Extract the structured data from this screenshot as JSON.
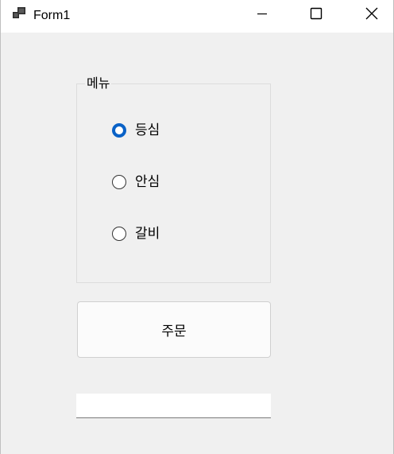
{
  "window": {
    "title": "Form1",
    "controls": {
      "minimize": "minimize",
      "maximize": "maximize",
      "close": "close"
    }
  },
  "menu_group": {
    "label": "메뉴",
    "options": [
      {
        "label": "등심",
        "checked": true
      },
      {
        "label": "안심",
        "checked": false
      },
      {
        "label": "갈비",
        "checked": false
      }
    ]
  },
  "order_button": {
    "label": "주문"
  },
  "result_textbox": {
    "value": ""
  },
  "colors": {
    "accent": "#0a62c7",
    "client_background": "#f0f0f0",
    "titlebar_background": "#ffffff"
  }
}
